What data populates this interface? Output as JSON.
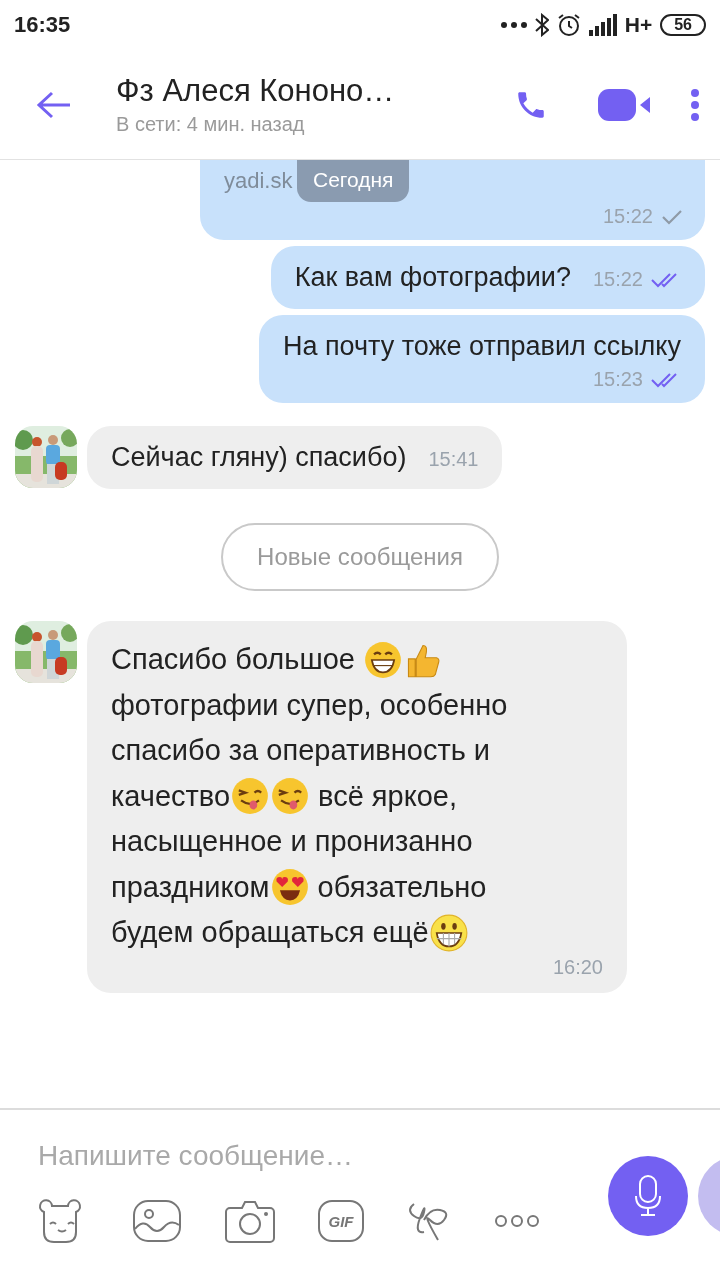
{
  "status_bar": {
    "time": "16:35",
    "network": "H+",
    "battery": "56"
  },
  "header": {
    "title": "Фз Алеся Кононо…",
    "subtitle": "В сети: 4 мин. назад"
  },
  "date_chip": "Сегодня",
  "messages": [
    {
      "kind": "outgoing",
      "cut": true,
      "lines": [
        [
          {
            "kind": "link",
            "text": "yadi.sk"
          }
        ]
      ],
      "time": "15:22",
      "read": false
    },
    {
      "kind": "outgoing",
      "lines": [
        [
          {
            "kind": "text",
            "text": "Как вам фотографии?"
          }
        ]
      ],
      "time": "15:22",
      "read": true
    },
    {
      "kind": "outgoing",
      "lines": [
        [
          {
            "kind": "text",
            "text": "На почту тоже отправил ссылку"
          }
        ]
      ],
      "time": "15:23",
      "read": true
    },
    {
      "kind": "incoming",
      "lines": [
        [
          {
            "kind": "text",
            "text": "Сейчас гляну) спасибо)"
          }
        ]
      ],
      "time": "15:41"
    },
    {
      "kind": "divider",
      "label": "Новые сообщения"
    },
    {
      "kind": "incoming",
      "lines": [
        [
          {
            "kind": "text",
            "text": "Спасибо большое "
          },
          {
            "kind": "grin"
          },
          {
            "kind": "thumbs"
          }
        ],
        [
          {
            "kind": "text",
            "text": "фотографии супер, особенно"
          }
        ],
        [
          {
            "kind": "text",
            "text": "спасибо за оперативность и"
          }
        ],
        [
          {
            "kind": "text",
            "text": "качество"
          },
          {
            "kind": "wink"
          },
          {
            "kind": "wink"
          },
          {
            "kind": "text",
            "text": " всё яркое,"
          }
        ],
        [
          {
            "kind": "text",
            "text": "насыщенное и пронизанно"
          }
        ],
        [
          {
            "kind": "text",
            "text": "праздником"
          },
          {
            "kind": "hearts"
          },
          {
            "kind": "text",
            "text": " обязательно"
          }
        ],
        [
          {
            "kind": "text",
            "text": "будем обращаться ещё"
          },
          {
            "kind": "smile"
          }
        ]
      ],
      "time": "16:20"
    }
  ],
  "composer": {
    "placeholder": "Напишите сообщение…",
    "gif_label": "GIF"
  }
}
